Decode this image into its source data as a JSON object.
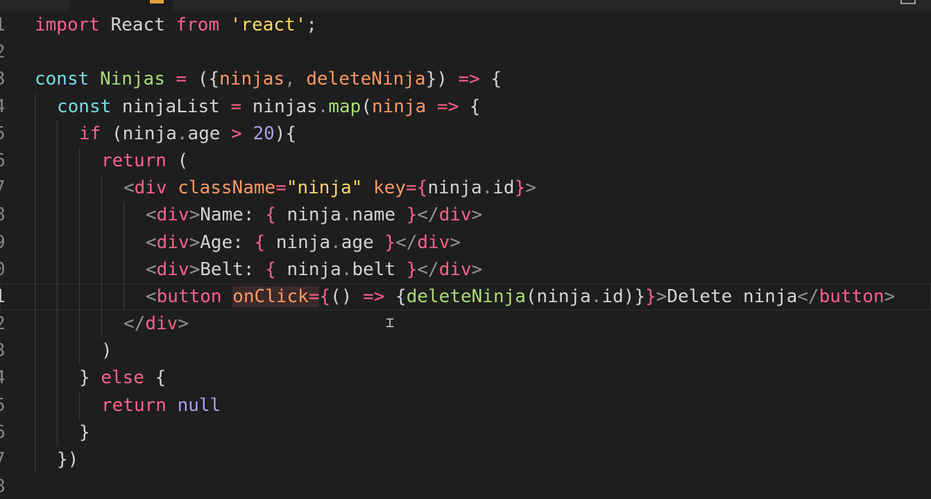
{
  "editor": {
    "accent_colors": {
      "keyword": "#fc618d",
      "function": "#a9dc76",
      "string": "#ffd866",
      "number": "#ab9df2",
      "parameter": "#fc9867",
      "storage": "#78dce8"
    },
    "lines": [
      {
        "n": "1",
        "indent": 0,
        "tokens": [
          {
            "t": "import",
            "c": "kw"
          },
          {
            "t": " React ",
            "c": "id"
          },
          {
            "t": "from",
            "c": "kw"
          },
          {
            "t": " ",
            "c": "id"
          },
          {
            "t": "'react'",
            "c": "str"
          },
          {
            "t": ";",
            "c": "id"
          }
        ]
      },
      {
        "n": "2",
        "indent": 0,
        "tokens": []
      },
      {
        "n": "3",
        "indent": 0,
        "tokens": [
          {
            "t": "const",
            "c": "kw2"
          },
          {
            "t": " ",
            "c": "id"
          },
          {
            "t": "Ninjas",
            "c": "fn"
          },
          {
            "t": " ",
            "c": "id"
          },
          {
            "t": "=",
            "c": "op"
          },
          {
            "t": " ({",
            "c": "id"
          },
          {
            "t": "ninjas",
            "c": "param"
          },
          {
            "t": ", ",
            "c": "pun"
          },
          {
            "t": "deleteNinja",
            "c": "param"
          },
          {
            "t": "}) ",
            "c": "id"
          },
          {
            "t": "=>",
            "c": "op"
          },
          {
            "t": " {",
            "c": "id"
          }
        ]
      },
      {
        "n": "4",
        "indent": 1,
        "tokens": [
          {
            "t": "const",
            "c": "kw2"
          },
          {
            "t": " ninjaList ",
            "c": "id"
          },
          {
            "t": "=",
            "c": "op"
          },
          {
            "t": " ninjas",
            "c": "id"
          },
          {
            "t": ".",
            "c": "pun"
          },
          {
            "t": "map",
            "c": "fn"
          },
          {
            "t": "(",
            "c": "id"
          },
          {
            "t": "ninja",
            "c": "param"
          },
          {
            "t": " ",
            "c": "id"
          },
          {
            "t": "=>",
            "c": "op"
          },
          {
            "t": " {",
            "c": "id"
          }
        ]
      },
      {
        "n": "5",
        "indent": 2,
        "tokens": [
          {
            "t": "if",
            "c": "kw"
          },
          {
            "t": " (ninja",
            "c": "id"
          },
          {
            "t": ".",
            "c": "pun"
          },
          {
            "t": "age ",
            "c": "id"
          },
          {
            "t": ">",
            "c": "op"
          },
          {
            "t": " ",
            "c": "id"
          },
          {
            "t": "20",
            "c": "num"
          },
          {
            "t": "){",
            "c": "id"
          }
        ]
      },
      {
        "n": "6",
        "indent": 3,
        "tokens": [
          {
            "t": "return",
            "c": "kw"
          },
          {
            "t": " (",
            "c": "id"
          }
        ]
      },
      {
        "n": "7",
        "indent": 4,
        "tokens": [
          {
            "t": "<",
            "c": "pun"
          },
          {
            "t": "div",
            "c": "tag"
          },
          {
            "t": " ",
            "c": "id"
          },
          {
            "t": "className",
            "c": "attr"
          },
          {
            "t": "=",
            "c": "op"
          },
          {
            "t": "\"ninja\"",
            "c": "str"
          },
          {
            "t": " ",
            "c": "id"
          },
          {
            "t": "key",
            "c": "attr"
          },
          {
            "t": "={",
            "c": "op"
          },
          {
            "t": "ninja",
            "c": "id"
          },
          {
            "t": ".",
            "c": "pun"
          },
          {
            "t": "id",
            "c": "id"
          },
          {
            "t": "}",
            "c": "op"
          },
          {
            "t": ">",
            "c": "pun"
          }
        ]
      },
      {
        "n": "8",
        "indent": 5,
        "tokens": [
          {
            "t": "<",
            "c": "pun"
          },
          {
            "t": "div",
            "c": "tag"
          },
          {
            "t": ">",
            "c": "pun"
          },
          {
            "t": "Name: ",
            "c": "txt"
          },
          {
            "t": "{",
            "c": "op"
          },
          {
            "t": " ninja",
            "c": "id"
          },
          {
            "t": ".",
            "c": "pun"
          },
          {
            "t": "name ",
            "c": "id"
          },
          {
            "t": "}",
            "c": "op"
          },
          {
            "t": "</",
            "c": "pun"
          },
          {
            "t": "div",
            "c": "tag"
          },
          {
            "t": ">",
            "c": "pun"
          }
        ]
      },
      {
        "n": "9",
        "indent": 5,
        "tokens": [
          {
            "t": "<",
            "c": "pun"
          },
          {
            "t": "div",
            "c": "tag"
          },
          {
            "t": ">",
            "c": "pun"
          },
          {
            "t": "Age: ",
            "c": "txt"
          },
          {
            "t": "{",
            "c": "op"
          },
          {
            "t": " ninja",
            "c": "id"
          },
          {
            "t": ".",
            "c": "pun"
          },
          {
            "t": "age ",
            "c": "id"
          },
          {
            "t": "}",
            "c": "op"
          },
          {
            "t": "</",
            "c": "pun"
          },
          {
            "t": "div",
            "c": "tag"
          },
          {
            "t": ">",
            "c": "pun"
          }
        ]
      },
      {
        "n": "0",
        "indent": 5,
        "tokens": [
          {
            "t": "<",
            "c": "pun"
          },
          {
            "t": "div",
            "c": "tag"
          },
          {
            "t": ">",
            "c": "pun"
          },
          {
            "t": "Belt: ",
            "c": "txt"
          },
          {
            "t": "{",
            "c": "op"
          },
          {
            "t": " ninja",
            "c": "id"
          },
          {
            "t": ".",
            "c": "pun"
          },
          {
            "t": "belt ",
            "c": "id"
          },
          {
            "t": "}",
            "c": "op"
          },
          {
            "t": "</",
            "c": "pun"
          },
          {
            "t": "div",
            "c": "tag"
          },
          {
            "t": ">",
            "c": "pun"
          }
        ]
      },
      {
        "n": "1",
        "indent": 5,
        "current": true,
        "tokens": [
          {
            "t": "<",
            "c": "pun"
          },
          {
            "t": "button",
            "c": "tag"
          },
          {
            "t": " ",
            "c": "id"
          },
          {
            "t": "onClick",
            "c": "attr hl"
          },
          {
            "t": "=",
            "c": "op hl"
          },
          {
            "t": "{",
            "c": "op"
          },
          {
            "t": "() ",
            "c": "id"
          },
          {
            "t": "=>",
            "c": "op"
          },
          {
            "t": " {",
            "c": "id"
          },
          {
            "t": "deleteNinja",
            "c": "fn"
          },
          {
            "t": "(ninja",
            "c": "id"
          },
          {
            "t": ".",
            "c": "pun"
          },
          {
            "t": "id)}",
            "c": "id"
          },
          {
            "t": "}",
            "c": "op"
          },
          {
            "t": ">",
            "c": "pun"
          },
          {
            "t": "Delete ninja",
            "c": "txt"
          },
          {
            "t": "</",
            "c": "pun"
          },
          {
            "t": "button",
            "c": "tag"
          },
          {
            "t": ">",
            "c": "pun"
          }
        ]
      },
      {
        "n": "2",
        "indent": 4,
        "tokens": [
          {
            "t": "</",
            "c": "pun"
          },
          {
            "t": "div",
            "c": "tag"
          },
          {
            "t": ">",
            "c": "pun"
          }
        ]
      },
      {
        "n": "3",
        "indent": 3,
        "tokens": [
          {
            "t": ")",
            "c": "id"
          }
        ]
      },
      {
        "n": "4",
        "indent": 2,
        "tokens": [
          {
            "t": "}",
            "c": "id"
          },
          {
            "t": " ",
            "c": "id"
          },
          {
            "t": "else",
            "c": "kw"
          },
          {
            "t": " {",
            "c": "id"
          }
        ]
      },
      {
        "n": "5",
        "indent": 3,
        "tokens": [
          {
            "t": "return",
            "c": "kw"
          },
          {
            "t": " ",
            "c": "id"
          },
          {
            "t": "null",
            "c": "num"
          }
        ]
      },
      {
        "n": "6",
        "indent": 2,
        "tokens": [
          {
            "t": "}",
            "c": "id"
          }
        ]
      },
      {
        "n": "7",
        "indent": 1,
        "tokens": [
          {
            "t": "})",
            "c": "id"
          }
        ]
      },
      {
        "n": "8",
        "indent": 0,
        "tokens": []
      }
    ]
  }
}
